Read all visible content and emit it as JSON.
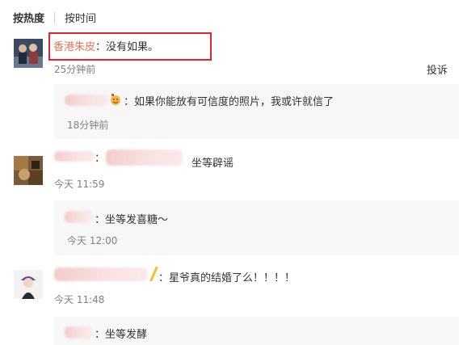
{
  "tabs": {
    "hot": "按热度",
    "time": "按时间"
  },
  "comments": [
    {
      "author": "香港朱皮",
      "text": "：没有如果。",
      "time": "25分钟前",
      "report": "投诉",
      "reply": {
        "text": "：如果你能放有可信度的照片，我或许就信了",
        "time": "18分钟前"
      }
    },
    {
      "text": "坐等辟谣",
      "colon": "：",
      "time": "今天 11:59",
      "reply": {
        "text": "：坐等发喜糖～",
        "time": "今天 12:00"
      }
    },
    {
      "text": "：星爷真的结婚了么！！！！",
      "time": "今天 11:48",
      "reply": {
        "text": "：坐等发酵"
      }
    }
  ]
}
